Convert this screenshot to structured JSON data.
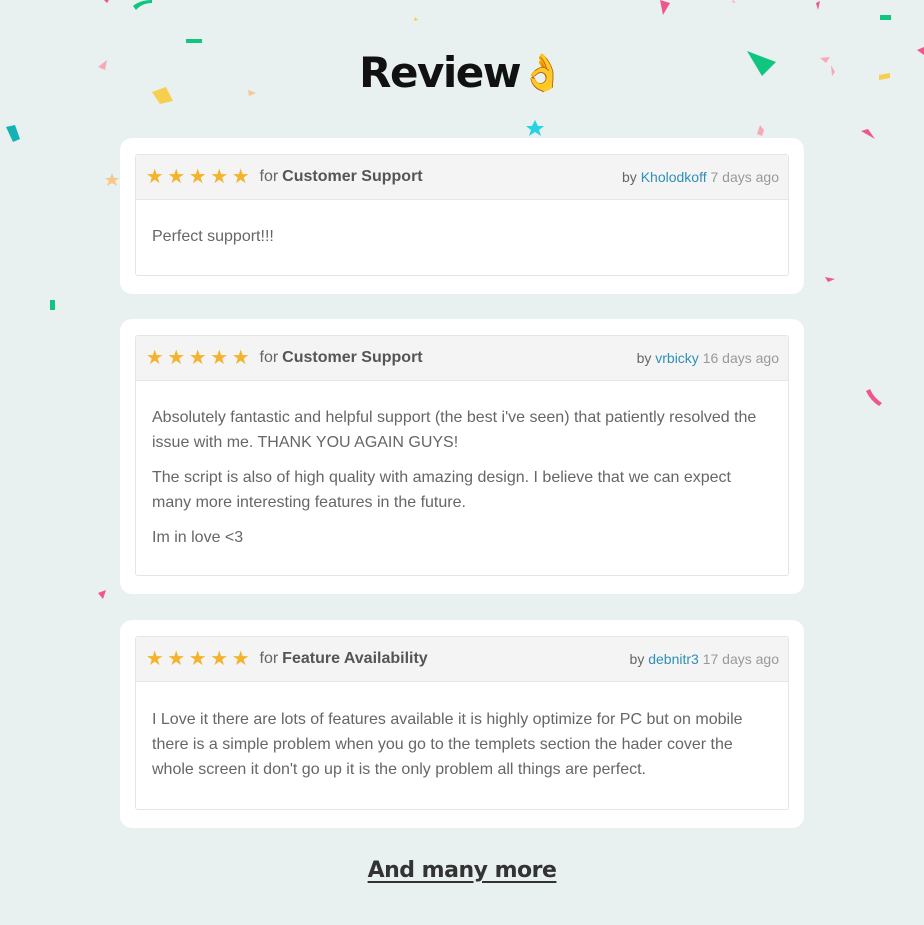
{
  "page": {
    "title": "Review",
    "title_emoji": "👌",
    "more_link": "And many more"
  },
  "colors": {
    "background": "#e9f0f0",
    "star": "#f4b32c",
    "author_link": "#2e8fb8",
    "confetti": [
      "#f0568c",
      "#0fc57f",
      "#f6cf4e",
      "#13b3b3",
      "#25d3e2",
      "#f7a9b7",
      "#f9c68c"
    ]
  },
  "reviews": [
    {
      "rating": 5,
      "stars": [
        "★",
        "★",
        "★",
        "★",
        "★"
      ],
      "for_label": "for",
      "category": "Customer Support",
      "by_label": "by",
      "author": "Kholodkoff",
      "time": "7 days ago",
      "paragraphs": [
        "Perfect support!!!"
      ]
    },
    {
      "rating": 5,
      "stars": [
        "★",
        "★",
        "★",
        "★",
        "★"
      ],
      "for_label": "for",
      "category": "Customer Support",
      "by_label": "by",
      "author": "vrbicky",
      "time": "16 days ago",
      "paragraphs": [
        "Absolutely fantastic and helpful support (the best i've seen) that patiently resolved the issue with me. THANK YOU AGAIN GUYS!",
        "The script is also of high quality with amazing design. I believe that we can expect many more interesting features in the future.",
        "Im in love <3"
      ]
    },
    {
      "rating": 5,
      "stars": [
        "★",
        "★",
        "★",
        "★",
        "★"
      ],
      "for_label": "for",
      "category": "Feature Availability",
      "by_label": "by",
      "author": "debnitr3",
      "time": "17 days ago",
      "paragraphs": [
        "I Love it there are lots of features available it is highly optimize for PC but on mobile there is a simple problem when you go to the templets section the hader cover the whole screen it don't go up it is the only problem all things are perfect."
      ]
    }
  ]
}
